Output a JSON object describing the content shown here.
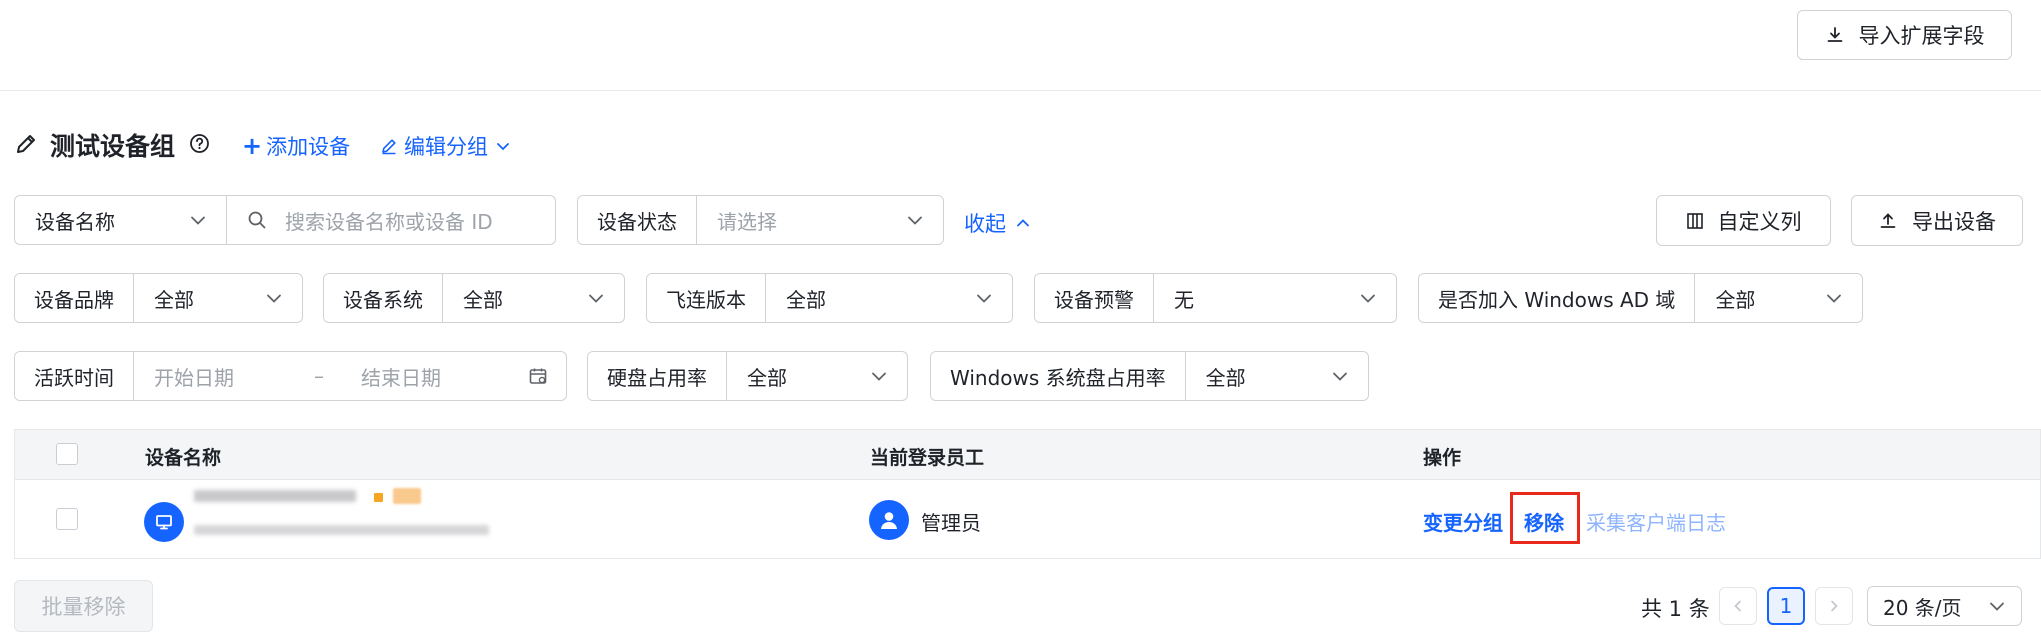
{
  "header": {
    "import_button": "导入扩展字段"
  },
  "group": {
    "title": "测试设备组",
    "add_device": "添加设备",
    "edit_group": "编辑分组"
  },
  "filters": {
    "name_select": "设备名称",
    "search_placeholder": "搜索设备名称或设备 ID",
    "status_label": "设备状态",
    "status_placeholder": "请选择",
    "collapse": "收起",
    "custom_columns": "自定义列",
    "export": "导出设备",
    "brand_label": "设备品牌",
    "brand_value": "全部",
    "system_label": "设备系统",
    "system_value": "全部",
    "feilian_label": "飞连版本",
    "feilian_value": "全部",
    "alert_label": "设备预警",
    "alert_value": "无",
    "ad_label": "是否加入 Windows AD 域",
    "ad_value": "全部",
    "active_label": "活跃时间",
    "start_placeholder": "开始日期",
    "range_sep": "–",
    "end_placeholder": "结束日期",
    "disk_label": "硬盘占用率",
    "disk_value": "全部",
    "win_disk_label": "Windows 系统盘占用率",
    "win_disk_value": "全部"
  },
  "table": {
    "columns": [
      "设备名称",
      "当前登录员工",
      "操作"
    ],
    "rows": [
      {
        "employee": "管理员",
        "actions": [
          "变更分组",
          "移除",
          "采集客户端日志"
        ]
      }
    ]
  },
  "footer": {
    "batch_remove": "批量移除",
    "total": "共 1 条",
    "current_page": "1",
    "page_size": "20 条/页"
  },
  "colors": {
    "primary": "#1664ff",
    "highlight_box": "#e8291c",
    "disabled_link": "#8fb4ff"
  }
}
